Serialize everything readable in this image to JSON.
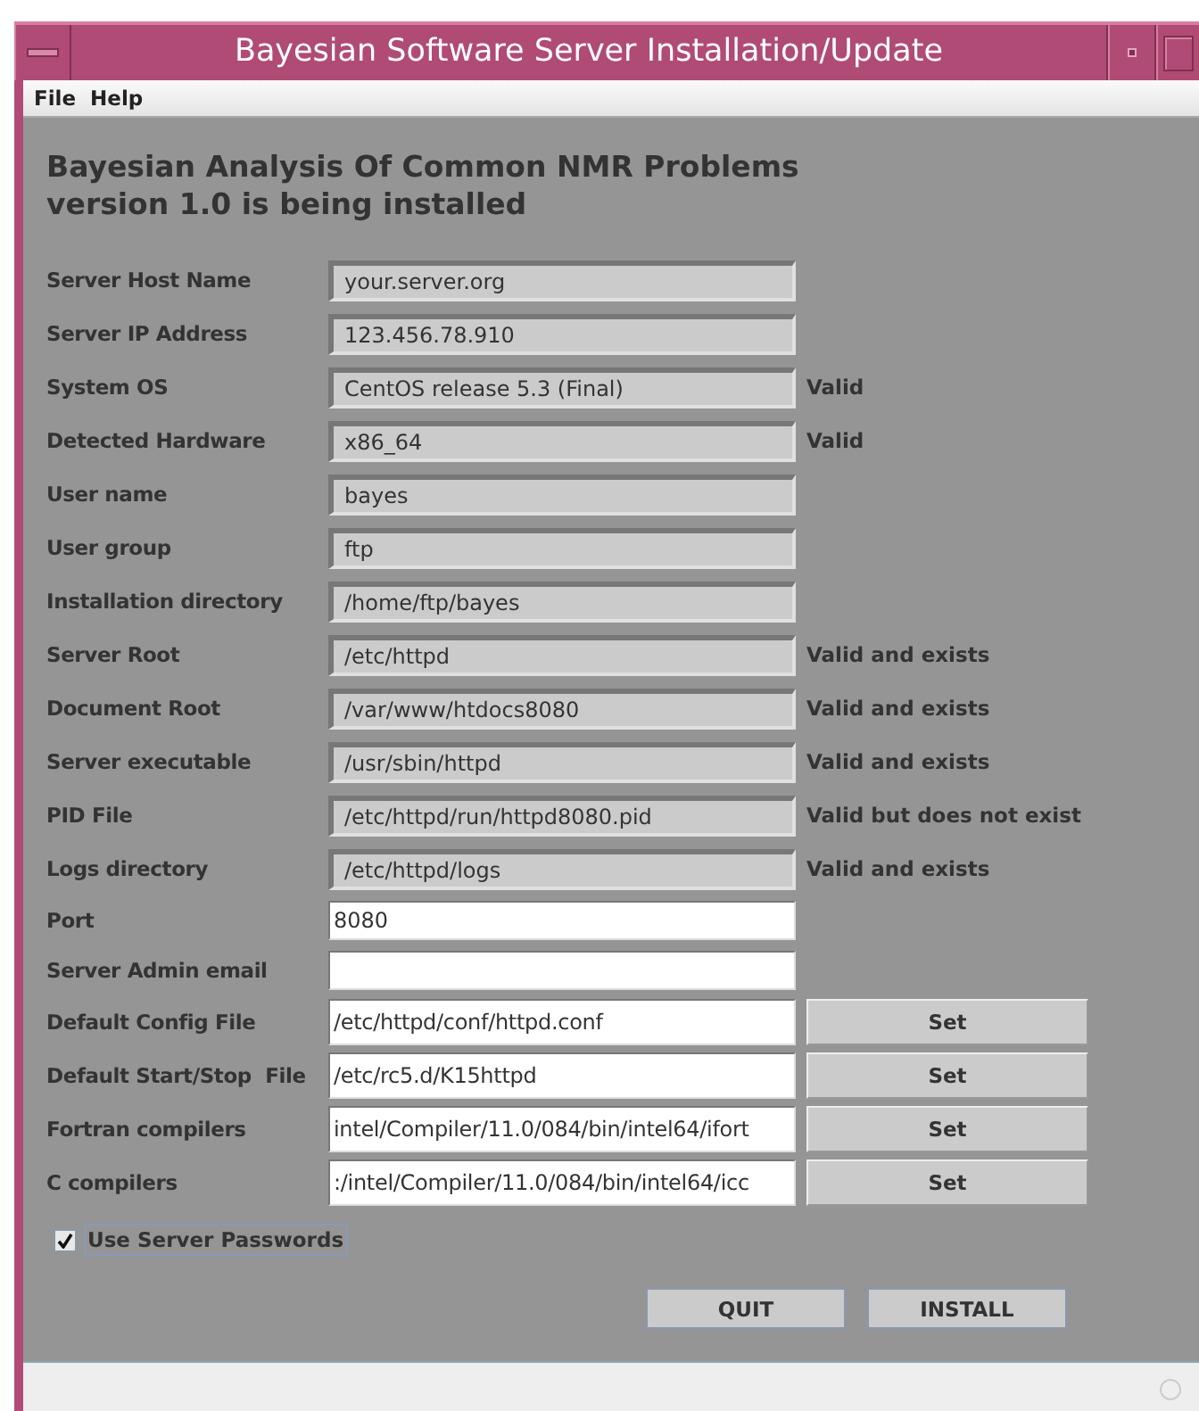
{
  "window": {
    "title": "Bayesian Software Server Installation/Update"
  },
  "menu": [
    "File",
    "Help"
  ],
  "heading": [
    "Bayesian Analysis Of Common NMR Problems",
    "version 1.0 is being installed"
  ],
  "fields": [
    {
      "label": "Server Host Name",
      "kind": "readonly",
      "value": "your.server.org"
    },
    {
      "label": "Server IP Address",
      "kind": "readonly",
      "value": "123.456.78.910"
    },
    {
      "label": "System OS",
      "kind": "readonly",
      "value": "CentOS release 5.3 (Final)",
      "status": "Valid"
    },
    {
      "label": "Detected Hardware",
      "kind": "readonly",
      "value": "x86_64",
      "status": "Valid"
    },
    {
      "label": "User name",
      "kind": "readonly",
      "value": "bayes"
    },
    {
      "label": "User group",
      "kind": "readonly",
      "value": "ftp"
    },
    {
      "label": "Installation directory",
      "kind": "readonly",
      "value": "/home/ftp/bayes"
    },
    {
      "label": "Server Root",
      "kind": "readonly",
      "value": "/etc/httpd",
      "status": "Valid and exists"
    },
    {
      "label": "Document Root",
      "kind": "readonly",
      "value": "/var/www/htdocs8080",
      "status": "Valid and exists"
    },
    {
      "label": "Server executable",
      "kind": "readonly",
      "value": "/usr/sbin/httpd",
      "status": "Valid and exists"
    },
    {
      "label": "PID File",
      "kind": "readonly",
      "value": "/etc/httpd/run/httpd8080.pid",
      "status": "Valid but does not exist"
    },
    {
      "label": "Logs directory",
      "kind": "readonly",
      "value": "/etc/httpd/logs",
      "status": "Valid and exists"
    },
    {
      "label": "Port",
      "kind": "editable",
      "value": "8080"
    },
    {
      "label": "Server Admin email",
      "kind": "editable"
    },
    {
      "label": "Default Config File",
      "kind": "file",
      "value": "/etc/httpd/conf/httpd.conf",
      "button": "Set"
    },
    {
      "label": "Default Start/Stop  File",
      "kind": "file",
      "value": "/etc/rc5.d/K15httpd",
      "button": "Set"
    },
    {
      "label": "Fortran compilers",
      "kind": "file",
      "value": "intel/Compiler/11.0/084/bin/intel64/ifort",
      "button": "Set"
    },
    {
      "label": "C compilers",
      "kind": "file",
      "value": ":/intel/Compiler/11.0/084/bin/intel64/icc",
      "button": "Set"
    }
  ],
  "use_server_passwords": {
    "label": "Use Server Passwords",
    "checked": true
  },
  "buttons": [
    "QUIT",
    "INSTALL"
  ]
}
